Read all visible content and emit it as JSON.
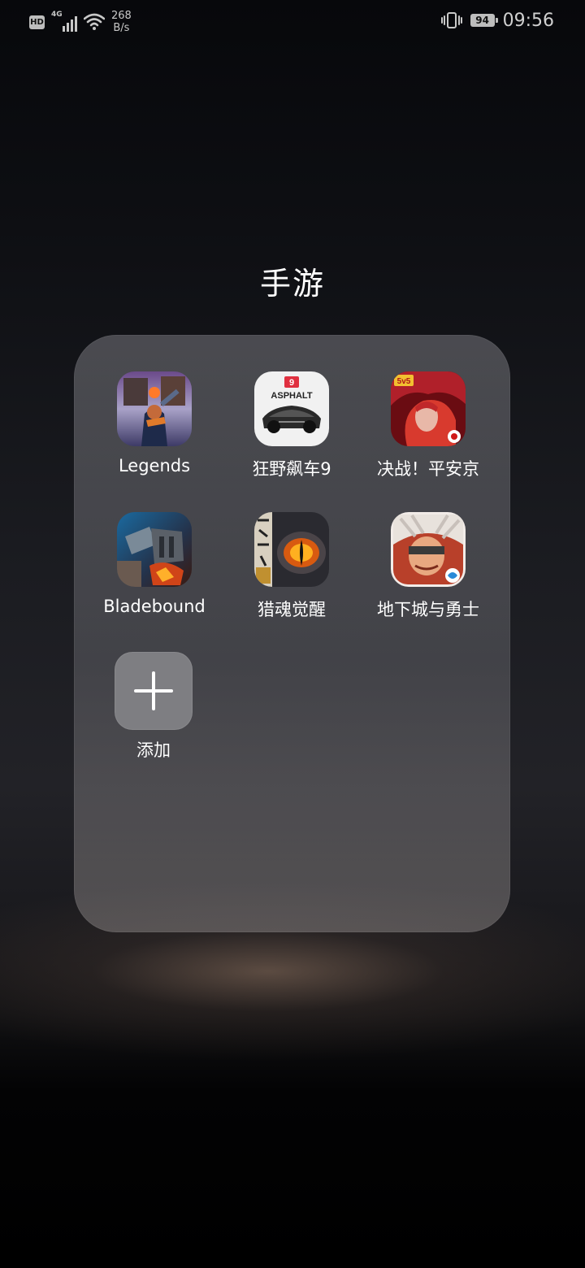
{
  "status_bar": {
    "hd_badge": "HD",
    "network_type": "4G",
    "net_speed_value": "268",
    "net_speed_unit": "B/s",
    "battery_level": "94",
    "time": "09:56",
    "icons": [
      "hd-icon",
      "cellular-signal-icon",
      "wifi-icon",
      "vibrate-icon",
      "battery-icon"
    ]
  },
  "folder": {
    "title": "手游",
    "apps": [
      {
        "label": "Legends",
        "icon": "legends-app-icon"
      },
      {
        "label": "狂野飙车9",
        "icon": "asphalt9-app-icon",
        "icon_text": "ASPHALT",
        "icon_badge": "9"
      },
      {
        "label": "决战！平安京",
        "icon": "onmyoji-arena-app-icon",
        "icon_badge": "5v5"
      },
      {
        "label": "Bladebound",
        "icon": "bladebound-app-icon"
      },
      {
        "label": "猎魂觉醒",
        "icon": "hunter-awakening-app-icon"
      },
      {
        "label": "地下城与勇士",
        "icon": "dnf-app-icon"
      }
    ],
    "add_button": {
      "label": "添加",
      "icon": "plus-icon"
    }
  },
  "colors": {
    "panel": "#6e6e74",
    "add_tile": "#7e7e82",
    "text": "#ffffff",
    "status_text": "#c8c8c8"
  }
}
